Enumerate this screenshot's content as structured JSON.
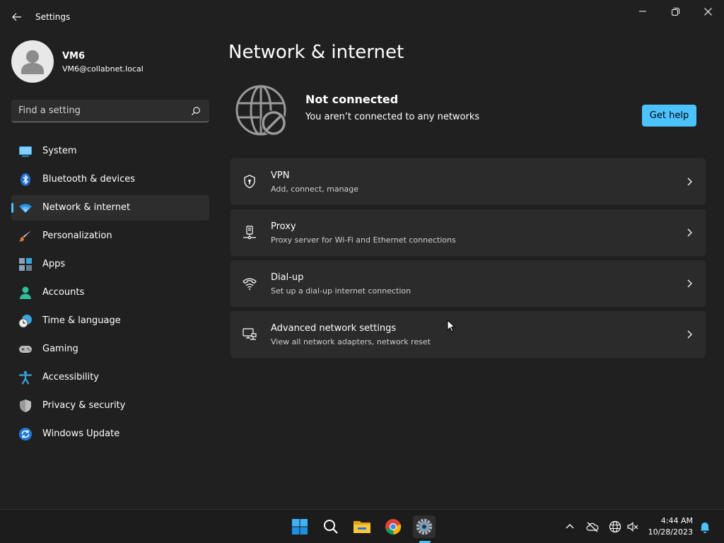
{
  "window": {
    "title": "Settings"
  },
  "profile": {
    "name": "VM6",
    "email": "VM6@collabnet.local"
  },
  "search": {
    "placeholder": "Find a setting"
  },
  "nav": {
    "items": [
      {
        "label": "System",
        "icon": "monitor-icon"
      },
      {
        "label": "Bluetooth & devices",
        "icon": "bluetooth-icon"
      },
      {
        "label": "Network & internet",
        "icon": "wifi-icon",
        "active": true
      },
      {
        "label": "Personalization",
        "icon": "brush-icon"
      },
      {
        "label": "Apps",
        "icon": "apps-icon"
      },
      {
        "label": "Accounts",
        "icon": "person-icon"
      },
      {
        "label": "Time & language",
        "icon": "clock-globe-icon"
      },
      {
        "label": "Gaming",
        "icon": "gamepad-icon"
      },
      {
        "label": "Accessibility",
        "icon": "accessibility-icon"
      },
      {
        "label": "Privacy & security",
        "icon": "shield-icon"
      },
      {
        "label": "Windows Update",
        "icon": "update-icon"
      }
    ]
  },
  "main": {
    "title": "Network & internet",
    "status": {
      "title": "Not connected",
      "description": "You aren’t connected to any networks",
      "help_label": "Get help",
      "icon": "globe-disconnected-icon"
    },
    "cards": [
      {
        "title": "VPN",
        "subtitle": "Add, connect, manage",
        "icon": "vpn-shield-icon"
      },
      {
        "title": "Proxy",
        "subtitle": "Proxy server for Wi-Fi and Ethernet connections",
        "icon": "proxy-icon"
      },
      {
        "title": "Dial-up",
        "subtitle": "Set up a dial-up internet connection",
        "icon": "dialup-icon"
      },
      {
        "title": "Advanced network settings",
        "subtitle": "View all network adapters, network reset",
        "icon": "network-adapter-icon"
      }
    ]
  },
  "taskbar": {
    "apps": [
      "start-icon",
      "search-icon",
      "file-explorer-icon",
      "chrome-icon",
      "settings-icon"
    ],
    "time": "4:44 AM",
    "date": "10/28/2023"
  },
  "colors": {
    "accent": "#4cc2ff",
    "background": "#202020",
    "card": "#2b2b2b"
  }
}
